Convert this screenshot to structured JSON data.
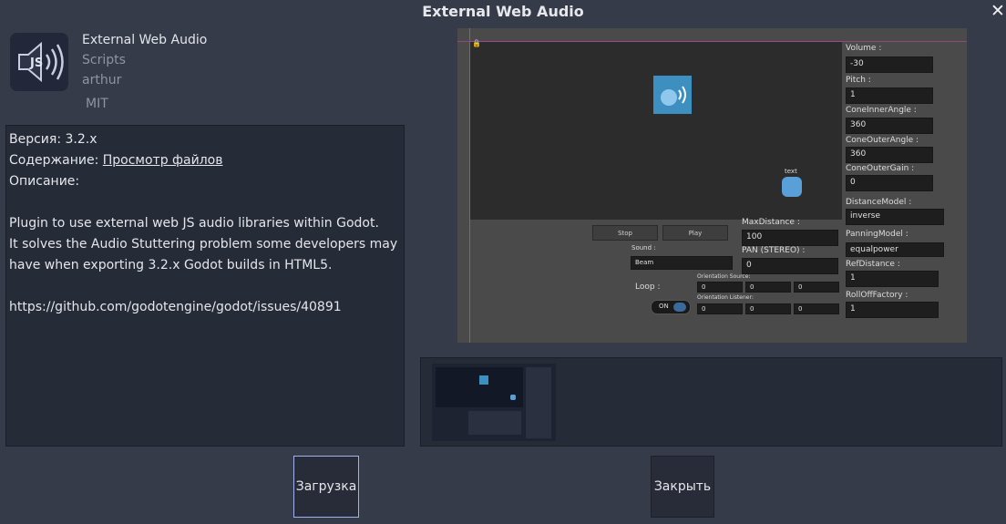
{
  "window": {
    "title": "External Web Audio",
    "close_glyph": "✕"
  },
  "asset": {
    "name": "External Web Audio",
    "category": "Scripts",
    "author": "arthur",
    "license": "MIT",
    "icon_text": "JS"
  },
  "details": {
    "version_label": "Версия:",
    "version_value": "3.2.x",
    "contents_label": "Содержание:",
    "contents_link": "Просмотр файлов",
    "description_label": "Описание:",
    "description_lines": [
      "Plugin to use external web JS audio libraries within Godot.",
      "It solves the Audio Stuttering problem some developers may",
      "have when exporting 3.2.x Godot builds in HTML5.",
      "https://github.com/godotengine/godot/issues/40891"
    ]
  },
  "preview": {
    "fields": {
      "volume_label": "Volume :",
      "volume_value": "-30",
      "pitch_label": "Pitch :",
      "pitch_value": "1",
      "cone_inner_label": "ConeInnerAngle :",
      "cone_inner_value": "360",
      "cone_outer_label": "ConeOuterAngle :",
      "cone_outer_value": "360",
      "cone_outer_gain_label": "ConeOuterGain :",
      "cone_outer_gain_value": "0",
      "distance_model_label": "DistanceModel :",
      "distance_model_value": "inverse",
      "panning_model_label": "PanningModel :",
      "panning_model_value": "equalpower",
      "ref_distance_label": "RefDistance :",
      "ref_distance_value": "1",
      "rolloff_label": "RollOffFactory :",
      "rolloff_value": "1",
      "max_distance_label": "MaxDistance :",
      "max_distance_value": "100",
      "pan_label": "PAN (STEREO) :",
      "pan_value": "0",
      "stop_label": "Stop",
      "play_label": "Play",
      "sound_label": "Sound :",
      "sound_value": "Beam",
      "loop_label": "Loop :",
      "toggle_label": "ON",
      "orientation_source_label": "Orientation Source:",
      "orientation_listener_label": "Orientation Listener:",
      "zero": "0",
      "sprite_text": "text"
    }
  },
  "buttons": {
    "download": "Загрузка",
    "close": "Закрыть"
  },
  "colors": {
    "background": "#353b49",
    "panel": "#262b38",
    "accent_border": "#9fb2ec"
  }
}
